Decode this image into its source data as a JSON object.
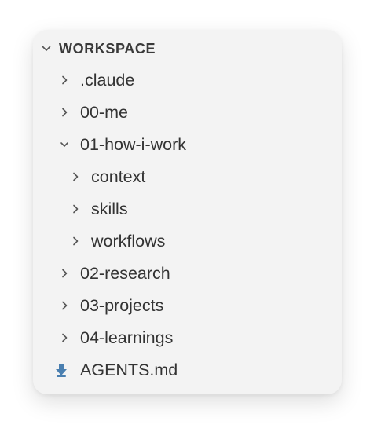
{
  "explorer": {
    "section_title": "WORKSPACE",
    "items": [
      {
        "label": ".claude",
        "type": "folder",
        "state": "collapsed",
        "depth": 0
      },
      {
        "label": "00-me",
        "type": "folder",
        "state": "collapsed",
        "depth": 0
      },
      {
        "label": "01-how-i-work",
        "type": "folder",
        "state": "expanded",
        "depth": 0
      },
      {
        "label": "context",
        "type": "folder",
        "state": "collapsed",
        "depth": 1
      },
      {
        "label": "skills",
        "type": "folder",
        "state": "collapsed",
        "depth": 1
      },
      {
        "label": "workflows",
        "type": "folder",
        "state": "collapsed",
        "depth": 1
      },
      {
        "label": "02-research",
        "type": "folder",
        "state": "collapsed",
        "depth": 0
      },
      {
        "label": "03-projects",
        "type": "folder",
        "state": "collapsed",
        "depth": 0
      },
      {
        "label": "04-learnings",
        "type": "folder",
        "state": "collapsed",
        "depth": 0
      },
      {
        "label": "AGENTS.md",
        "type": "file",
        "icon": "markdown-download-icon",
        "depth": 0
      }
    ]
  },
  "colors": {
    "panel_bg": "#f3f3f3",
    "text": "#333333",
    "chevron": "#555555",
    "md_icon": "#4a7fb0"
  }
}
